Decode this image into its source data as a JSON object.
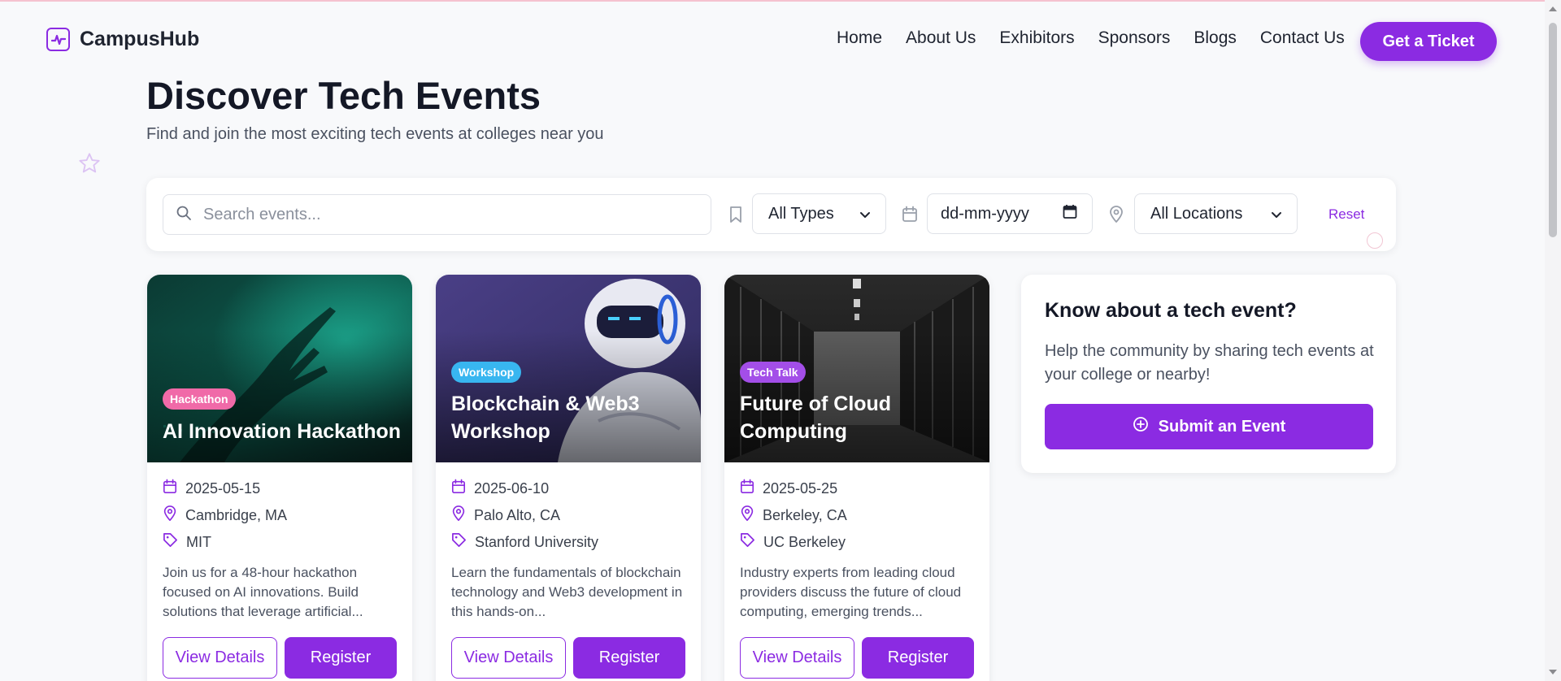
{
  "brand": {
    "name": "CampusHub",
    "accent": "#8b2be2"
  },
  "nav": {
    "items": [
      "Home",
      "About Us",
      "Exhibitors",
      "Sponsors",
      "Blogs",
      "Contact Us"
    ],
    "cta": "Get a Ticket"
  },
  "hero": {
    "title": "Discover Tech Events",
    "subtitle": "Find and join the most exciting tech events at colleges near you"
  },
  "filters": {
    "search_placeholder": "Search events...",
    "type_value": "All Types",
    "date_value": "dd-mm-yyyy",
    "location_value": "All Locations",
    "reset": "Reset"
  },
  "events": [
    {
      "badge": "Hackathon",
      "badge_color": "#f06aa8",
      "title": "AI Innovation Hackathon",
      "date": "2025-05-15",
      "location": "Cambridge, MA",
      "college": "MIT",
      "description": "Join us for a 48-hour hackathon focused on AI innovations. Build solutions that leverage artificial...",
      "details_label": "View Details",
      "register_label": "Register"
    },
    {
      "badge": "Workshop",
      "badge_color": "#38b6f0",
      "title": "Blockchain & Web3 Workshop",
      "date": "2025-06-10",
      "location": "Palo Alto, CA",
      "college": "Stanford University",
      "description": "Learn the fundamentals of blockchain technology and Web3 development in this hands-on...",
      "details_label": "View Details",
      "register_label": "Register"
    },
    {
      "badge": "Tech Talk",
      "badge_color": "#a34ee8",
      "title": "Future of Cloud Computing",
      "date": "2025-05-25",
      "location": "Berkeley, CA",
      "college": "UC Berkeley",
      "description": "Industry experts from leading cloud providers discuss the future of cloud computing, emerging trends...",
      "details_label": "View Details",
      "register_label": "Register"
    }
  ],
  "submit_panel": {
    "title": "Know about a tech event?",
    "text": "Help the community by sharing tech events at your college or nearby!",
    "button": "Submit an Event"
  }
}
